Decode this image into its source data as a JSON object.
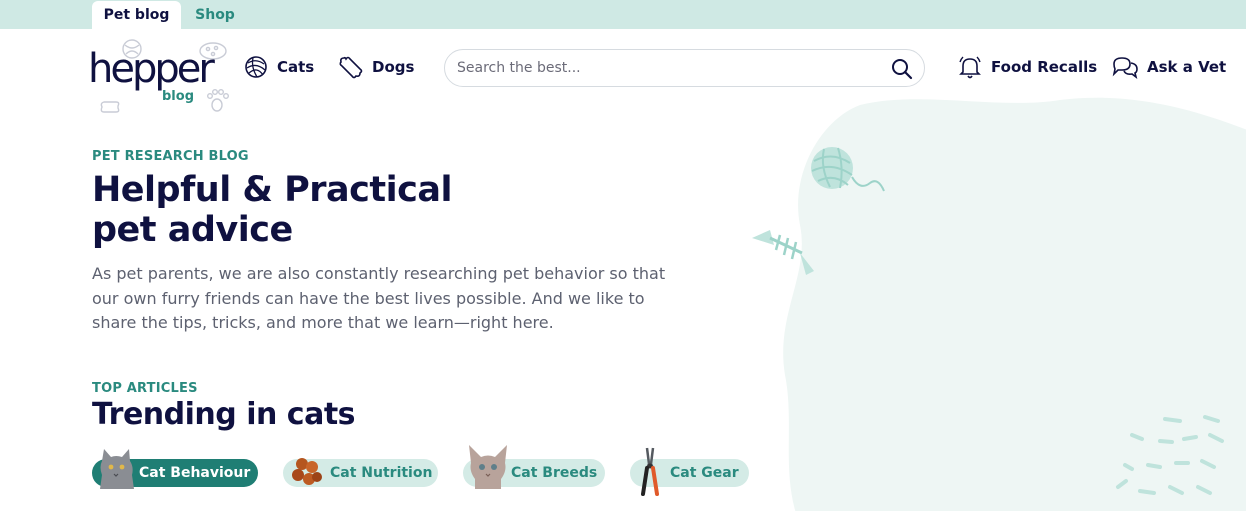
{
  "top_tabs": {
    "blog": "Pet blog",
    "shop": "Shop"
  },
  "logo": {
    "word": "hepper",
    "sub": "blog"
  },
  "nav": {
    "cats": "Cats",
    "dogs": "Dogs",
    "food_recalls": "Food Recalls",
    "ask_vet": "Ask a Vet"
  },
  "search": {
    "placeholder": "Search the best..."
  },
  "hero": {
    "eyebrow": "PET RESEARCH BLOG",
    "title_line1": "Helpful & Practical",
    "title_line2": "pet advice",
    "description": "As pet parents, we are also constantly researching pet behavior so that our own furry friends can have the best lives possible. And we like to share the tips, tricks, and more that we learn—right here."
  },
  "trending": {
    "eyebrow": "TOP ARTICLES",
    "title": "Trending in cats",
    "chips": [
      {
        "label": "Cat Behaviour",
        "active": true
      },
      {
        "label": "Cat Nutrition",
        "active": false
      },
      {
        "label": "Cat Breeds",
        "active": false
      },
      {
        "label": "Cat Gear",
        "active": false
      }
    ]
  },
  "colors": {
    "navy": "#0f1140",
    "teal": "#2a8a7f",
    "teal_dark": "#1f7e74",
    "mint": "#cfe9e4",
    "chip_bg": "#d4ebe6"
  }
}
